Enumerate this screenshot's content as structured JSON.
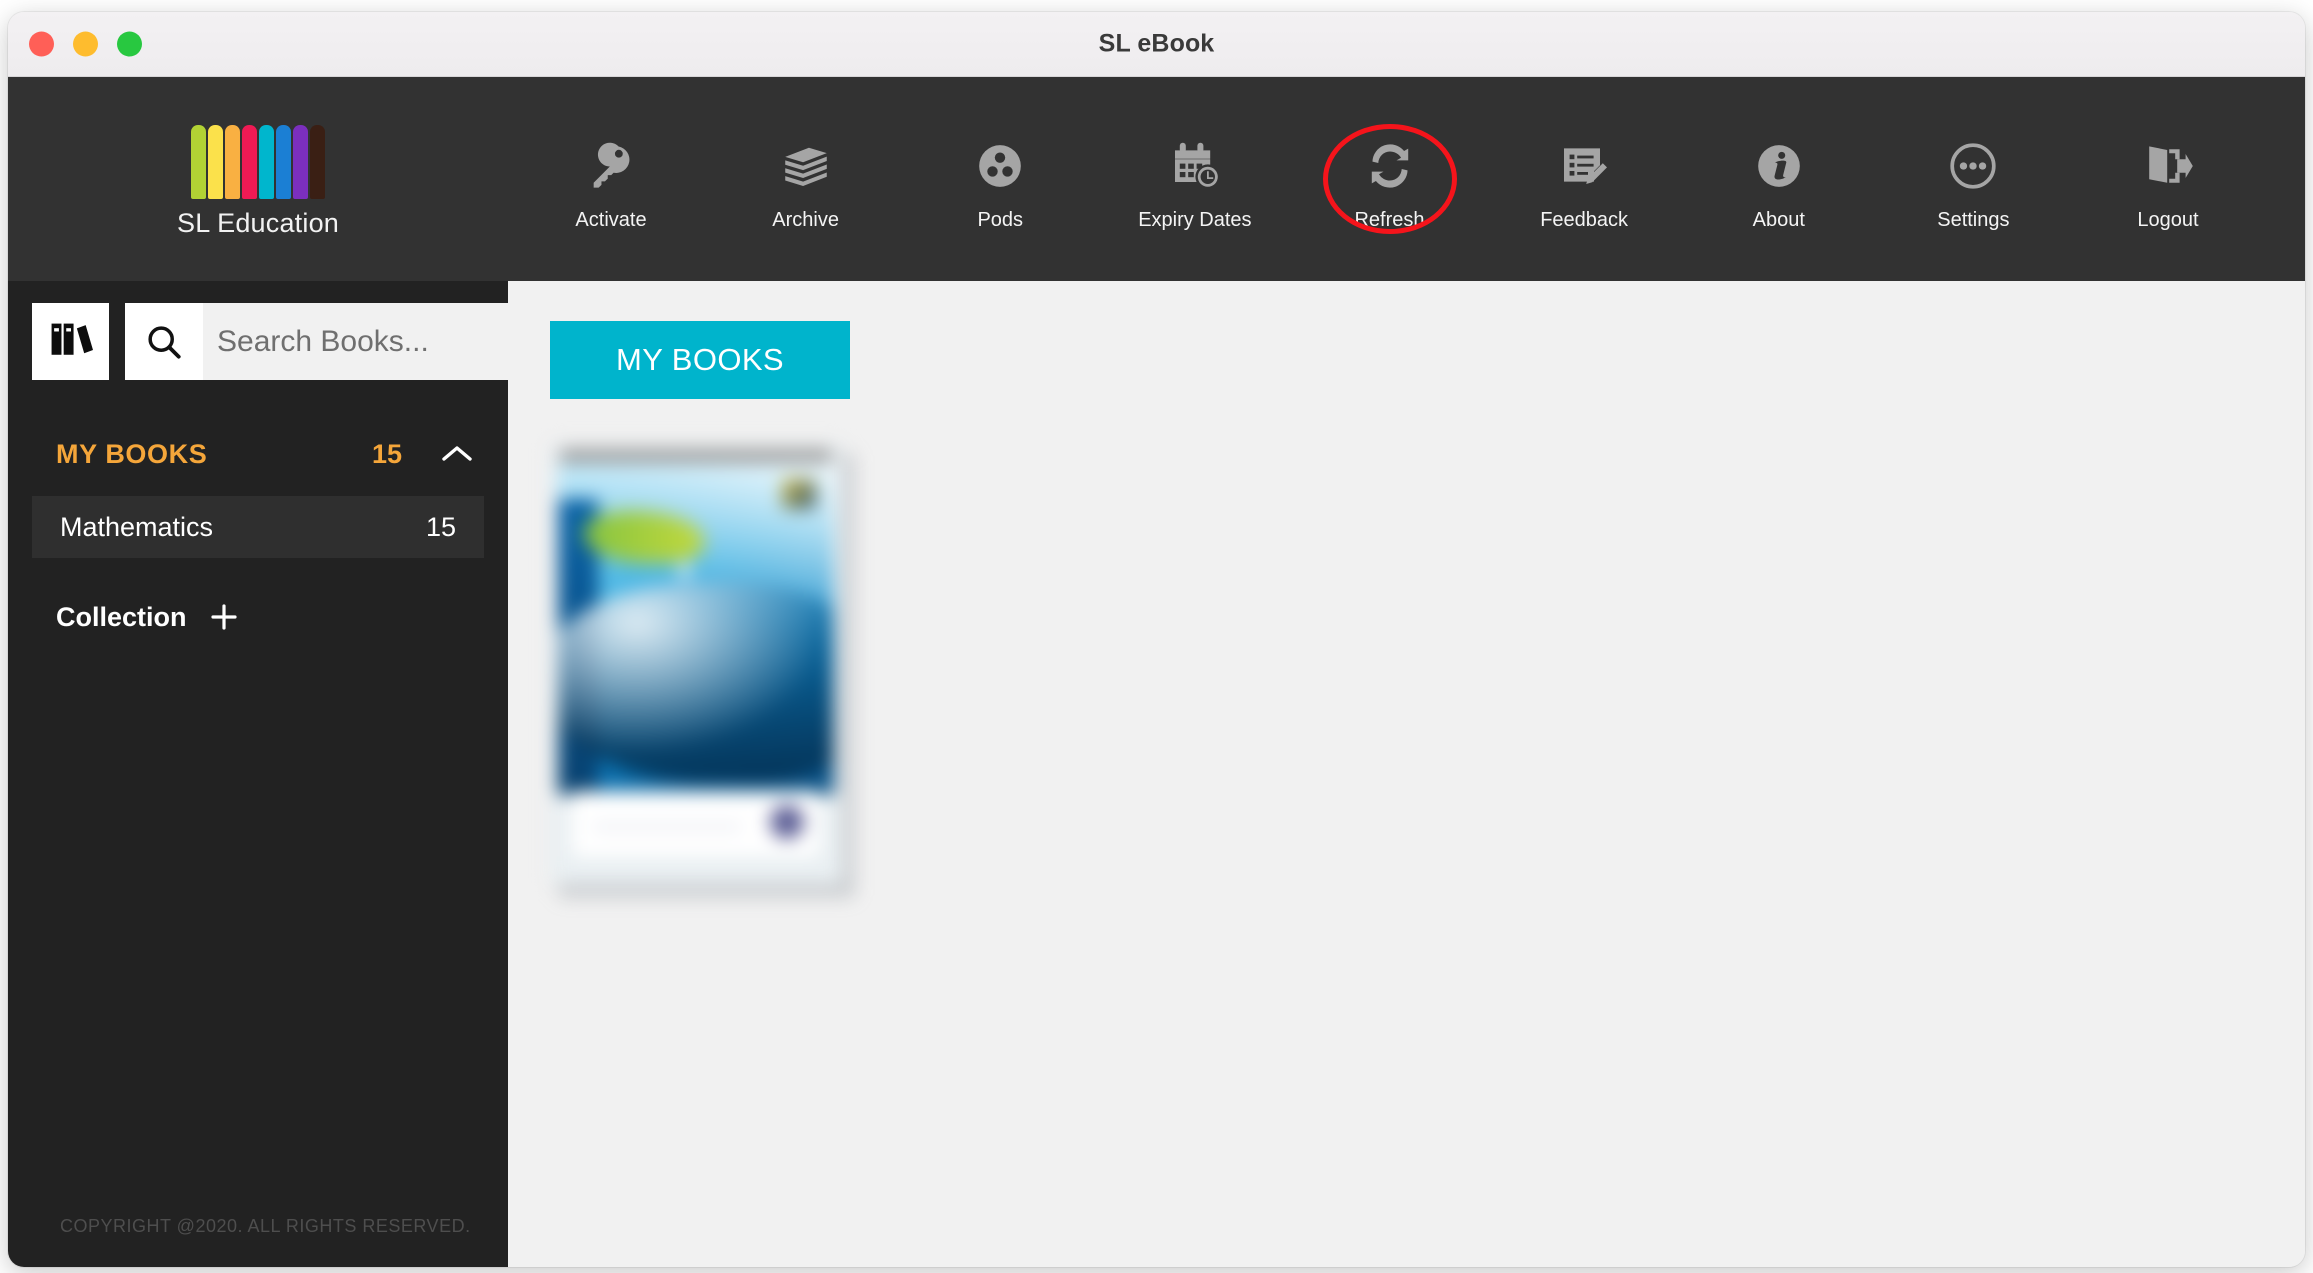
{
  "window": {
    "title": "SL eBook",
    "traffic_lights": [
      {
        "name": "close",
        "color": "#ff5f57"
      },
      {
        "name": "minimize",
        "color": "#febc2e"
      },
      {
        "name": "zoom",
        "color": "#28c840"
      }
    ]
  },
  "brand": {
    "name": "SL Education",
    "spine_colors": [
      "#b2d234",
      "#fbe14b",
      "#f9b042",
      "#ef1a54",
      "#00b6cd",
      "#1b7fd4",
      "#7b2fbe",
      "#3a1f14"
    ]
  },
  "toolbar": {
    "items": [
      {
        "label": "Activate",
        "icon": "key-icon"
      },
      {
        "label": "Archive",
        "icon": "books-stack-icon"
      },
      {
        "label": "Pods",
        "icon": "pods-circle-icon"
      },
      {
        "label": "Expiry Dates",
        "icon": "calendar-clock-icon"
      },
      {
        "label": "Refresh",
        "icon": "refresh-icon",
        "annotated": true
      },
      {
        "label": "Feedback",
        "icon": "form-pencil-icon"
      },
      {
        "label": "About",
        "icon": "info-circle-icon"
      },
      {
        "label": "Settings",
        "icon": "ellipsis-circle-icon"
      },
      {
        "label": "Logout",
        "icon": "logout-door-icon"
      }
    ],
    "annotation_color": "#f5141b",
    "background": "#323232"
  },
  "sidebar": {
    "library_button_icon": "library-books-icon",
    "search": {
      "icon": "search-icon",
      "placeholder": "Search Books...",
      "value": ""
    },
    "group": {
      "title": "MY BOOKS",
      "count": "15",
      "chevron": "chevron-up-icon",
      "expanded": true
    },
    "categories": [
      {
        "name": "Mathematics",
        "count": "15",
        "selected": true
      }
    ],
    "collection": {
      "label": "Collection",
      "add_icon": "plus-icon"
    },
    "copyright": "COPYRIGHT @2020. ALL RIGHTS RESERVED.",
    "background": "#222222",
    "accent": "#f5a63a"
  },
  "main": {
    "tab": {
      "label": "MY BOOKS",
      "color": "#00b4cc",
      "active": true
    },
    "books": [
      {
        "name": "book-thumbnail",
        "blurred": true
      }
    ],
    "background": "#f1f1f1"
  }
}
